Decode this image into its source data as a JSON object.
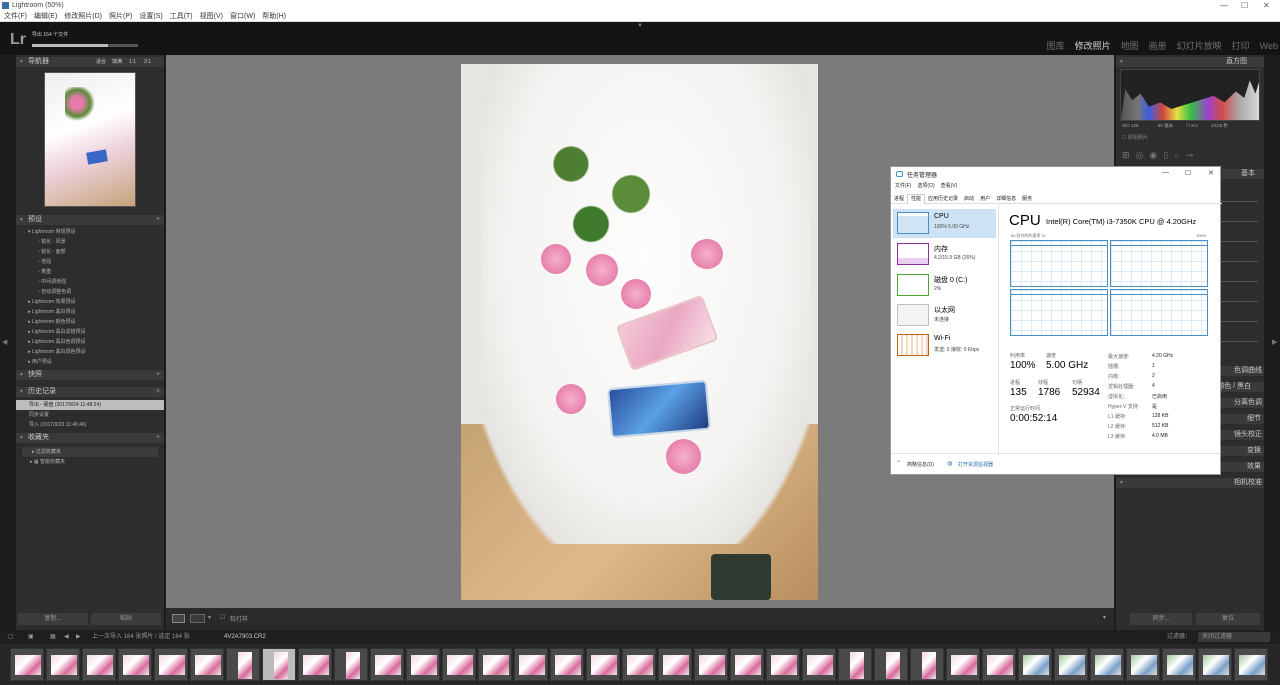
{
  "window": {
    "title": "Lightroom (50%)",
    "min": "—",
    "max": "☐",
    "close": "✕"
  },
  "menu": [
    "文件(F)",
    "编辑(E)",
    "修改照片(D)",
    "照片(P)",
    "设置(S)",
    "工具(T)",
    "视图(V)",
    "窗口(W)",
    "帮助(H)"
  ],
  "identity": {
    "logo": "Lr",
    "task": "导出 164 个文件",
    "progress": 0.72
  },
  "modules": [
    "图库",
    "修改照片",
    "地图",
    "画册",
    "幻灯片放映",
    "打印",
    "Web"
  ],
  "navigator": {
    "title": "导航器",
    "opts": [
      "适合",
      "填满",
      "1:1",
      "3:1"
    ]
  },
  "presets": {
    "title": "预设",
    "group_open": "Lightroom 常规预设",
    "items": [
      "锐化 - 风景",
      "锐化 - 面部",
      "增强",
      "着重",
      "中间调增强",
      "自动调整色调"
    ],
    "groups": [
      "Lightroom 效果预设",
      "Lightroom 黑白预设",
      "Lightroom 颜色预设",
      "Lightroom 黑白滤镜预设",
      "Lightroom 黑白色调预设",
      "Lightroom 黑白调色预设",
      "用户预设"
    ]
  },
  "snapshots": {
    "title": "快照"
  },
  "history": {
    "title": "历史记录",
    "items": [
      "导出 - 硬盘 (2017/9/24 11:48:24)",
      "同步设置",
      "导入 (2017/9/23 11:46:46)"
    ]
  },
  "collections": {
    "title": "收藏夹",
    "items": [
      "过滤收藏夹",
      "智能收藏夹"
    ]
  },
  "left_buttons": {
    "copy": "复制...",
    "paste": "粘贴"
  },
  "right_panel": {
    "histogram": "直方图",
    "hist_labels": [
      "ISO 125",
      "50 毫米",
      "f / 8.0",
      "1/125 秒"
    ],
    "original": "原始照片",
    "basic": "基本",
    "sections": [
      "色调曲线",
      "HSL / 颜色 / 黑白",
      "分离色调",
      "细节",
      "镜头校正",
      "变换",
      "效果",
      "相机校准"
    ],
    "sync": "同步...",
    "reset": "复位"
  },
  "toolbar": {
    "soft_proof": "软打样"
  },
  "filmstrip": {
    "source": "上一次导入 164 张照片 / 选定 164 张",
    "file": "4V2A7903.CR2",
    "filter_label": "过滤器：",
    "filter_value": "关闭过滤器"
  },
  "taskmgr": {
    "title": "任务管理器",
    "menu": [
      "文件(F)",
      "选项(O)",
      "查看(V)"
    ],
    "tabs": [
      "进程",
      "性能",
      "应用历史记录",
      "启动",
      "用户",
      "详细信息",
      "服务"
    ],
    "active_tab": "性能",
    "sidebar": [
      {
        "name": "CPU",
        "sub": "100% 5.00 GHz",
        "color": "#4a8fc4"
      },
      {
        "name": "内存",
        "sub": "4.2/15.9 GB (26%)",
        "color": "#8b2fa0"
      },
      {
        "name": "磁盘 0 (C:)",
        "sub": "2%",
        "color": "#4ea72e"
      },
      {
        "name": "以太网",
        "sub": "未连接",
        "color": "#a0a0a0"
      },
      {
        "name": "Wi-Fi",
        "sub": "发送: 0  接收: 0 Kbps",
        "color": "#c06010"
      }
    ],
    "heading": "CPU",
    "model": "Intel(R) Core(TM) i3-7350K CPU @ 4.20GHz",
    "graph_label": "60 秒内的利用率 %",
    "graph_max": "100%",
    "stats": [
      {
        "label": "利用率",
        "value": "100%"
      },
      {
        "label": "速度",
        "value": "5.00 GHz"
      },
      {
        "label": "进程",
        "value": "135"
      },
      {
        "label": "线程",
        "value": "1786"
      },
      {
        "label": "句柄",
        "value": "52934"
      }
    ],
    "uptime_label": "正常运行时间",
    "uptime": "0:00:52:14",
    "specs": [
      {
        "k": "最大速度:",
        "v": "4.20 GHz"
      },
      {
        "k": "插槽:",
        "v": "1"
      },
      {
        "k": "内核:",
        "v": "2"
      },
      {
        "k": "逻辑处理器:",
        "v": "4"
      },
      {
        "k": "虚拟化:",
        "v": "已启用"
      },
      {
        "k": "Hyper-V 支持:",
        "v": "是"
      },
      {
        "k": "L1 缓存:",
        "v": "128 KB"
      },
      {
        "k": "L2 缓存:",
        "v": "512 KB"
      },
      {
        "k": "L3 缓存:",
        "v": "4.0 MB"
      }
    ],
    "fewer": "简略信息(D)",
    "open_monitor": "打开资源监视器"
  }
}
